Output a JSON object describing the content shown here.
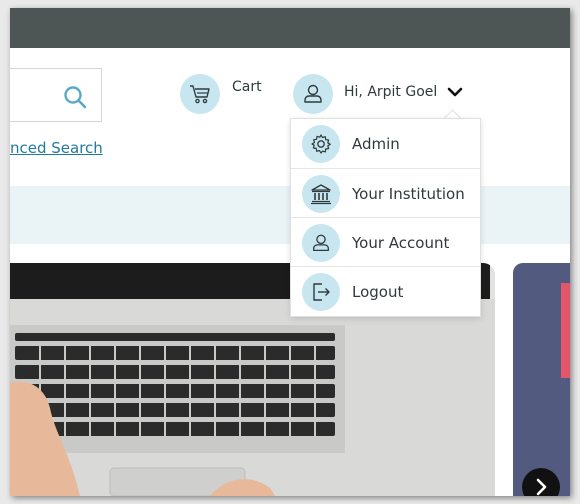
{
  "header": {
    "cart_label": "Cart",
    "user_greeting": "Hi, Arpit Goel",
    "advanced_search_label": "nced Search"
  },
  "user_menu": {
    "items": [
      {
        "label": "Admin",
        "icon": "gear-icon"
      },
      {
        "label": "Your Institution",
        "icon": "institution-icon"
      },
      {
        "label": "Your Account",
        "icon": "user-icon"
      },
      {
        "label": "Logout",
        "icon": "logout-icon"
      }
    ]
  },
  "colors": {
    "topbar": "#4e5555",
    "icon_circle": "#c7e6f0",
    "link": "#1f7a9c",
    "band": "#eaf4f7",
    "card_accent": "#525a80",
    "card_stripe": "#e3566a"
  }
}
